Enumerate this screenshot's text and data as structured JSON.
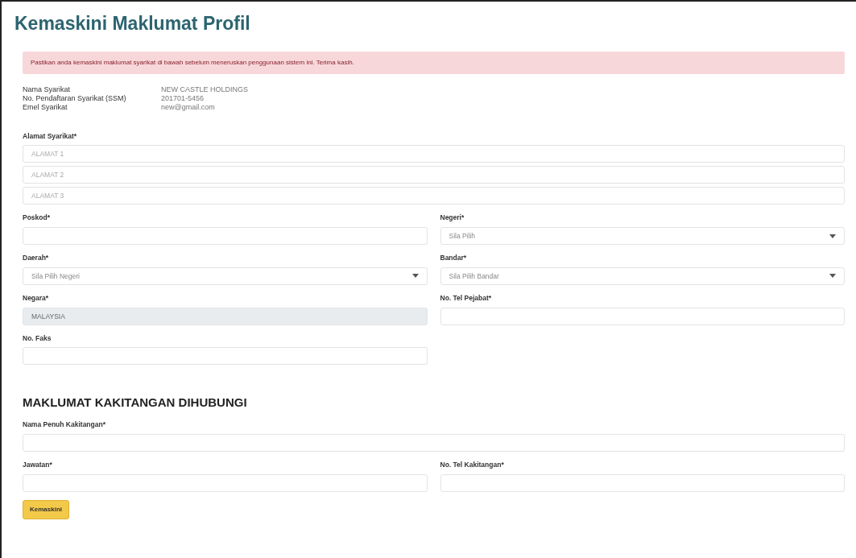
{
  "title": "Kemaskini Maklumat Profil",
  "alert": "Pastikan anda kemaskini maklumat syarikat di bawah sebelum meneruskan penggunaan sistem ini. Terima kasih.",
  "company_info": [
    {
      "label": "Nama Syarikat",
      "value": "NEW CASTLE HOLDINGS"
    },
    {
      "label": "No. Pendaftaran Syarikat (SSM)",
      "value": "201701-5456"
    },
    {
      "label": "Emel Syarikat",
      "value": "new@gmail.com"
    }
  ],
  "address": {
    "label": "Alamat Syarikat*",
    "lines": [
      {
        "placeholder": "ALAMAT 1"
      },
      {
        "placeholder": "ALAMAT 2"
      },
      {
        "placeholder": "ALAMAT 3"
      }
    ]
  },
  "fields": [
    {
      "label": "Poskod*",
      "kind": "text",
      "disabled": false
    },
    {
      "label": "Negeri*",
      "kind": "select",
      "value": "Sila Pilih",
      "disabled": false
    },
    {
      "label": "Daerah*",
      "kind": "select",
      "value": "Sila Pilih Negeri",
      "disabled": false
    },
    {
      "label": "Bandar*",
      "kind": "select",
      "value": "Sila Pilih Bandar",
      "disabled": false
    },
    {
      "label": "Negara*",
      "kind": "text",
      "value": "MALAYSIA",
      "disabled": true
    },
    {
      "label": "No. Tel Pejabat*",
      "kind": "text",
      "disabled": false
    },
    {
      "label": "No. Faks",
      "kind": "text",
      "disabled": false
    }
  ],
  "contact_section": {
    "heading": "MAKLUMAT KAKITANGAN DIHUBUNGI",
    "name_field": {
      "label": "Nama Penuh Kakitangan*",
      "kind": "text",
      "disabled": false
    },
    "fields": [
      {
        "label": "Jawatan*",
        "kind": "text",
        "disabled": false
      },
      {
        "label": "No. Tel Kakitangan*",
        "kind": "text",
        "disabled": false
      }
    ]
  },
  "submit_button": "Kemaskini"
}
